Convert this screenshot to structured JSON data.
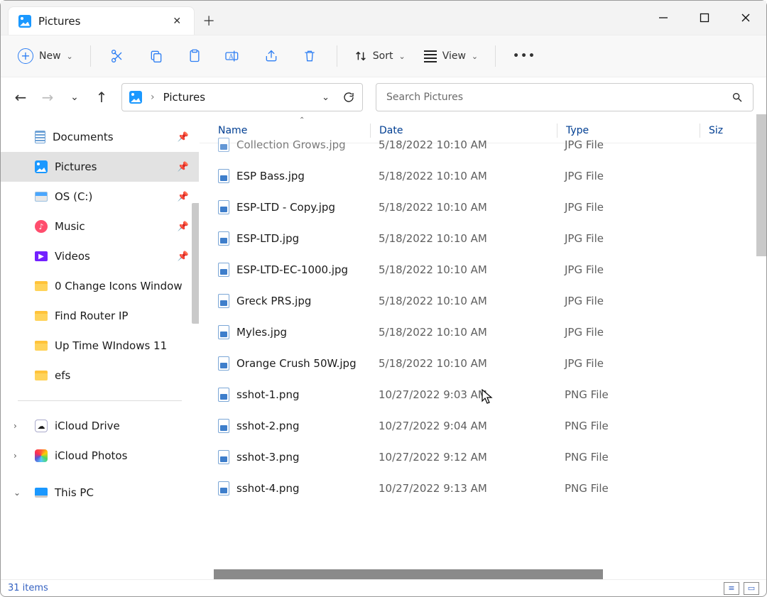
{
  "tab": {
    "title": "Pictures"
  },
  "toolbar": {
    "new_label": "New",
    "sort_label": "Sort",
    "view_label": "View"
  },
  "address": {
    "crumb": "Pictures"
  },
  "search": {
    "placeholder": "Search Pictures"
  },
  "columns": {
    "name": "Name",
    "date": "Date",
    "type": "Type",
    "size": "Siz"
  },
  "sidebar": {
    "items": [
      {
        "label": "Documents",
        "icon": "doc",
        "pinned": true,
        "sel": false
      },
      {
        "label": "Pictures",
        "icon": "pic",
        "pinned": true,
        "sel": true
      },
      {
        "label": "OS (C:)",
        "icon": "drive",
        "pinned": true,
        "sel": false
      },
      {
        "label": "Music",
        "icon": "music",
        "pinned": true,
        "sel": false
      },
      {
        "label": "Videos",
        "icon": "video",
        "pinned": true,
        "sel": false
      },
      {
        "label": "0 Change Icons Window",
        "icon": "folder",
        "pinned": false,
        "sel": false
      },
      {
        "label": "Find Router IP",
        "icon": "folder",
        "pinned": false,
        "sel": false
      },
      {
        "label": "Up Time WIndows 11",
        "icon": "folder",
        "pinned": false,
        "sel": false
      },
      {
        "label": "efs",
        "icon": "folder",
        "pinned": false,
        "sel": false
      }
    ],
    "cloud": [
      {
        "label": "iCloud Drive",
        "icon": "cloud",
        "expander": ">"
      },
      {
        "label": "iCloud Photos",
        "icon": "photos",
        "expander": ">"
      }
    ],
    "thispc": {
      "label": "This PC",
      "expander": "v"
    }
  },
  "files": [
    {
      "name": "Collection Grows.jpg",
      "date": "5/18/2022 10:10 AM",
      "type": "JPG File",
      "cut": true
    },
    {
      "name": "ESP Bass.jpg",
      "date": "5/18/2022 10:10 AM",
      "type": "JPG File"
    },
    {
      "name": "ESP-LTD - Copy.jpg",
      "date": "5/18/2022 10:10 AM",
      "type": "JPG File"
    },
    {
      "name": "ESP-LTD.jpg",
      "date": "5/18/2022 10:10 AM",
      "type": "JPG File"
    },
    {
      "name": "ESP-LTD-EC-1000.jpg",
      "date": "5/18/2022 10:10 AM",
      "type": "JPG File"
    },
    {
      "name": "Greck PRS.jpg",
      "date": "5/18/2022 10:10 AM",
      "type": "JPG File"
    },
    {
      "name": "Myles.jpg",
      "date": "5/18/2022 10:10 AM",
      "type": "JPG File"
    },
    {
      "name": "Orange Crush 50W.jpg",
      "date": "5/18/2022 10:10 AM",
      "type": "JPG File"
    },
    {
      "name": "sshot-1.png",
      "date": "10/27/2022 9:03 AM",
      "type": "PNG File"
    },
    {
      "name": "sshot-2.png",
      "date": "10/27/2022 9:04 AM",
      "type": "PNG File"
    },
    {
      "name": "sshot-3.png",
      "date": "10/27/2022 9:12 AM",
      "type": "PNG File"
    },
    {
      "name": "sshot-4.png",
      "date": "10/27/2022 9:13 AM",
      "type": "PNG File"
    }
  ],
  "status": {
    "count": "31 items"
  }
}
